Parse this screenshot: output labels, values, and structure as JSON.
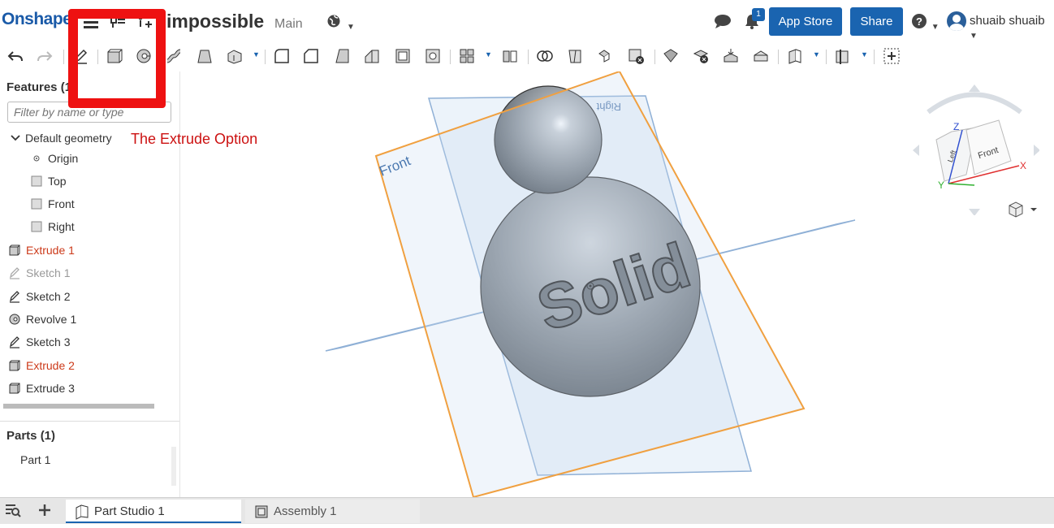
{
  "header": {
    "logo": "Onshape",
    "document_title": "impossible",
    "branch": "Main",
    "notification_count": "1",
    "app_store_label": "App Store",
    "share_label": "Share",
    "user_name": "shuaib shuaib"
  },
  "annotation": {
    "text": "The Extrude Option",
    "color": "#ee1111"
  },
  "feature_panel": {
    "title": "Features (1",
    "title_suffix": ")",
    "filter_placeholder": "Filter by name or type",
    "default_geometry": "Default geometry",
    "origin": "Origin",
    "planes": [
      "Top",
      "Front",
      "Right"
    ],
    "features": [
      {
        "label": "Extrude 1",
        "state": "error",
        "icon": "extrude-icon"
      },
      {
        "label": "Sketch 1",
        "state": "hidden",
        "icon": "sketch-icon"
      },
      {
        "label": "Sketch 2",
        "state": "normal",
        "icon": "sketch-icon"
      },
      {
        "label": "Revolve 1",
        "state": "normal",
        "icon": "revolve-icon"
      },
      {
        "label": "Sketch 3",
        "state": "normal",
        "icon": "sketch-icon"
      },
      {
        "label": "Extrude 2",
        "state": "error",
        "icon": "extrude-icon"
      },
      {
        "label": "Extrude 3",
        "state": "normal",
        "icon": "extrude-icon"
      }
    ],
    "parts_title": "Parts (1)",
    "parts": [
      "Part 1"
    ]
  },
  "viewport": {
    "plane_labels": {
      "front": "Front",
      "right": "Right"
    },
    "text_on_model": "Solid",
    "view_cube": {
      "face_front": "Front",
      "face_left": "Left",
      "axis_x": "X",
      "axis_y": "Y",
      "axis_z": "Z"
    }
  },
  "tabs": [
    {
      "label": "Part Studio 1",
      "active": true
    },
    {
      "label": "Assembly 1",
      "active": false
    }
  ],
  "colors": {
    "brand": "#1a64b0",
    "error_feature": "#cc3a1a",
    "plane_edge": "#f0a040",
    "plane_fill": "#c8dcf0"
  }
}
